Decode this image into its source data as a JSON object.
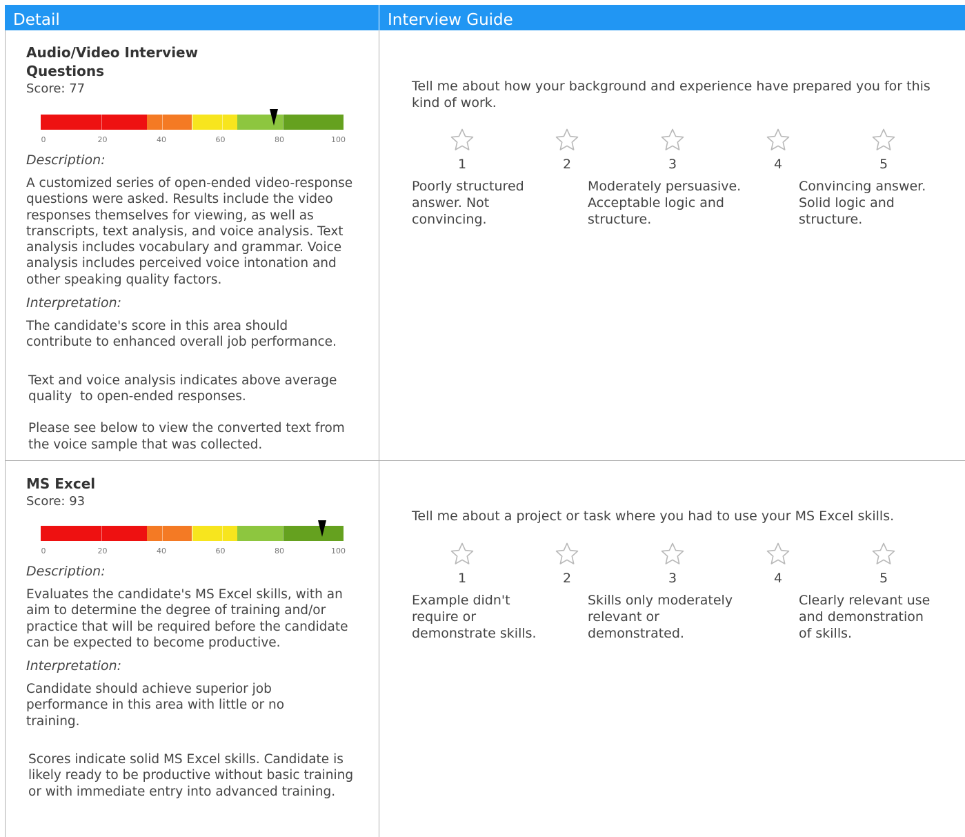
{
  "header": {
    "detail": "Detail",
    "guide": "Interview Guide"
  },
  "sections": [
    {
      "title": "Audio/Video Interview Questions",
      "score_label": "Score: 77",
      "score": 77,
      "axis_labels": [
        "0",
        "20",
        "40",
        "60",
        "80",
        "100"
      ],
      "description_label": "Description:",
      "description": "A customized series of open-ended video-response questions were asked. Results include the video responses themselves for viewing, as well as  transcripts, text analysis, and voice analysis. Text analysis includes vocabulary and grammar. Voice analysis includes perceived voice intonation and other speaking quality factors.",
      "interpretation_label": "Interpretation:",
      "interpretation": "The candidate's score in this area should contribute to enhanced overall job performance.",
      "note1": "Text and voice analysis indicates above average quality  to open-ended responses.",
      "note2": "Please see below to view the converted text from the voice sample that was collected.",
      "question": "Tell me about how your background and experience have prepared you for this kind of work.",
      "ratings": [
        "1",
        "2",
        "3",
        "4",
        "5"
      ],
      "anchors": [
        "Poorly structured answer. Not convincing.",
        "Moderately persuasive. Acceptable logic and structure.",
        "Convincing answer. Solid logic and structure."
      ]
    },
    {
      "title": "MS Excel",
      "score_label": "Score: 93",
      "score": 93,
      "axis_labels": [
        "0",
        "20",
        "40",
        "60",
        "80",
        "100"
      ],
      "description_label": "Description:",
      "description": "Evaluates the candidate's MS Excel skills, with an aim to determine the degree of training and/or practice that will be required before the candidate can be expected to become productive.",
      "interpretation_label": "Interpretation:",
      "interpretation": "Candidate should achieve superior job performance in this area with little or no training.",
      "note1": "Scores indicate solid MS Excel skills. Candidate is likely ready to be productive without basic training or with immediate entry into advanced training.",
      "question": "Tell me about a project or task where you had to use your MS Excel skills.",
      "ratings": [
        "1",
        "2",
        "3",
        "4",
        "5"
      ],
      "anchors": [
        "Example didn't require or demonstrate skills.",
        "Skills only moderately relevant or demonstrated.",
        "Clearly relevant use and demonstration of skills."
      ]
    }
  ],
  "colors": {
    "header": "#2196f3",
    "bar_segments": [
      "#ee1111",
      "#f47a24",
      "#f7e51e",
      "#8dc63f",
      "#65a11f"
    ]
  }
}
